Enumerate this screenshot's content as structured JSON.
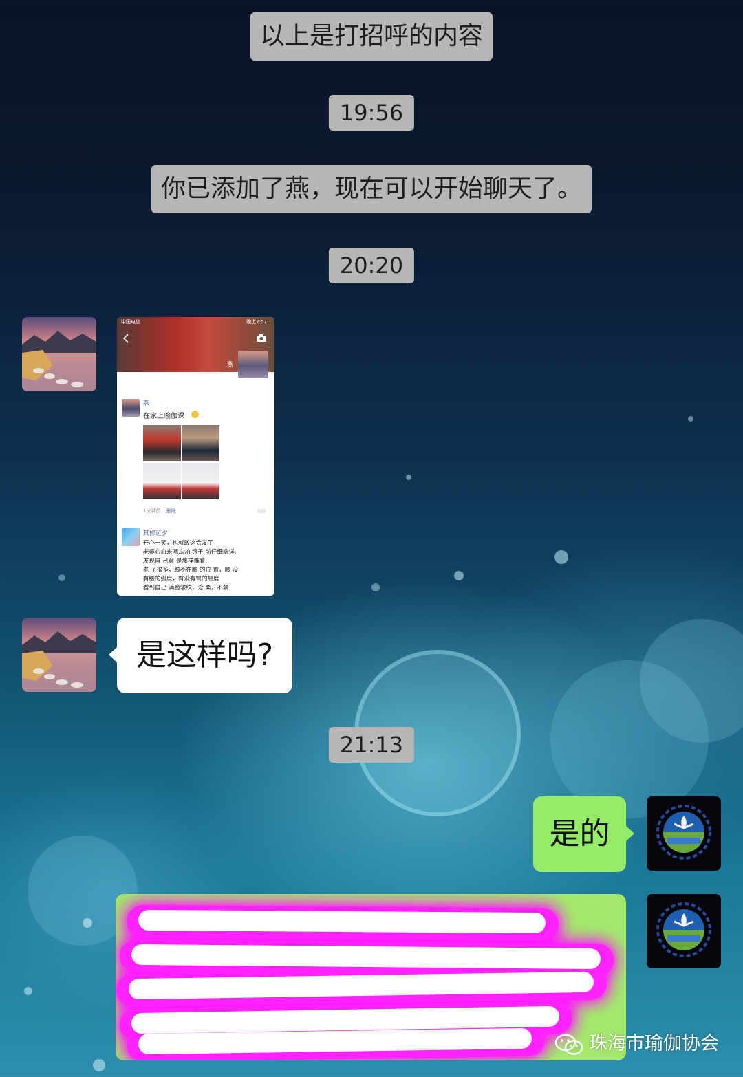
{
  "colors": {
    "timestamp_bg": "#b7b7b7",
    "incoming_bubble": "#ffffff",
    "outgoing_bubble": "#95ec69",
    "redaction": "#ff14ff"
  },
  "messages": {
    "system_greeting": "以上是打招呼的内容",
    "time_1": "19:56",
    "system_added": "你已添加了燕，现在可以开始聊天了。",
    "time_2": "20:20",
    "incoming_question": "是这样吗?",
    "time_3": "21:13",
    "outgoing_reply": "是的"
  },
  "screenshot": {
    "status_left": "中国电信",
    "status_right": "晚上7:57",
    "back_icon": "chevron-left-icon",
    "camera_icon": "camera-icon",
    "profile_name": "燕",
    "post_author": "燕",
    "post_text": "在家上瑜伽课",
    "post_meta": "1分钟前",
    "post_delete": "删除",
    "post2_author": "其修远夕",
    "post2_lines": [
      "开心一笑，也就敢这会发了",
      "老婆心血来潮,站在镜子 前仔细端详,",
      "发现自 己竟 是那样难看,",
      "老 了很多，胸不在胸 的位 置，腰 没",
      "有腰的弧度，臀没有臀的翘度",
      "看到自己 满脸皱纹，沧 桑，不禁"
    ]
  },
  "watermark": {
    "text": "珠海市瑜伽协会",
    "icon": "wechat-icon"
  }
}
